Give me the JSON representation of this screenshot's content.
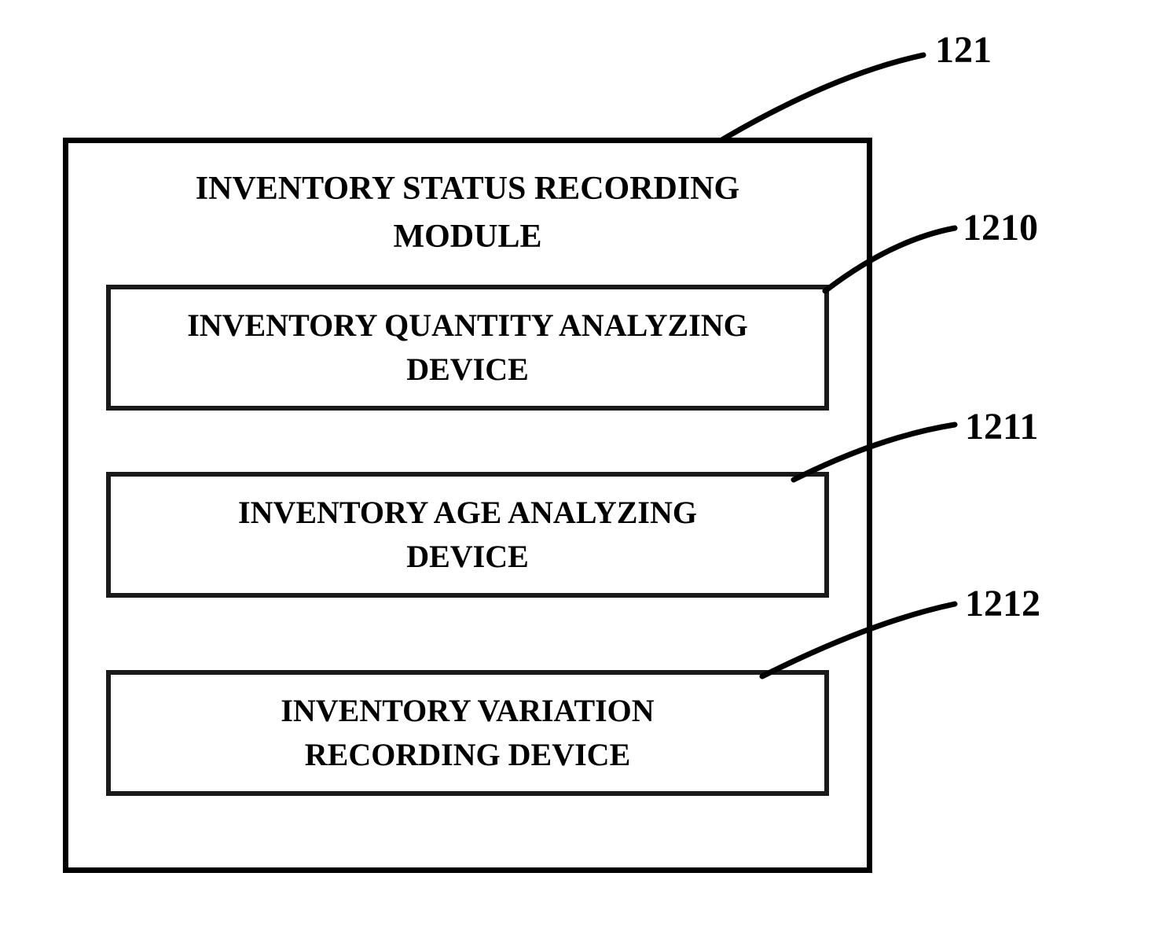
{
  "module": {
    "title_line1": "INVENTORY STATUS RECORDING",
    "title_line2": "MODULE",
    "ref": "121",
    "devices": [
      {
        "line1": "INVENTORY QUANTITY ANALYZING",
        "line2": "DEVICE",
        "ref": "1210"
      },
      {
        "line1": "INVENTORY AGE ANALYZING",
        "line2": "DEVICE",
        "ref": "1211"
      },
      {
        "line1": "INVENTORY VARIATION",
        "line2": "RECORDING DEVICE",
        "ref": "1212"
      }
    ]
  }
}
